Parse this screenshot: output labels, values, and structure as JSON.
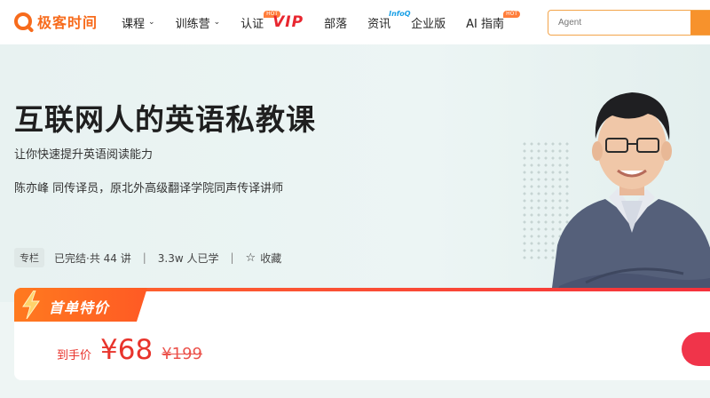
{
  "nav": {
    "logo_text": "极客时间",
    "items": [
      {
        "label": "课程",
        "has_dropdown": true
      },
      {
        "label": "训练营",
        "has_dropdown": true
      },
      {
        "label": "认证",
        "badge": "HOT"
      },
      {
        "label": "VIP"
      },
      {
        "label": "部落"
      },
      {
        "label": "资讯",
        "badge": "InfoQ"
      },
      {
        "label": "企业版"
      },
      {
        "label": "AI 指南",
        "badge": "HOT"
      }
    ],
    "search_placeholder": "Agent"
  },
  "hero": {
    "title": "互联网人的英语私教课",
    "subtitle": "让你快速提升英语阅读能力",
    "author": "陈亦峰   同传译员，原北外高级翻译学院同声传译讲师",
    "tag": "专栏",
    "lessons": "已完结·共 44 讲",
    "learners": "3.3w 人已学",
    "separator": "|",
    "favorite": "收藏"
  },
  "price": {
    "promo": "首单特价",
    "label": "到手价",
    "current": "¥68",
    "original": "¥199"
  },
  "colors": {
    "brand": "#f76b1c",
    "price": "#e8342c",
    "vip": "#e8262f"
  },
  "icons": [
    "logo-icon",
    "chevron-down-icon",
    "star-icon",
    "lightning-icon"
  ]
}
